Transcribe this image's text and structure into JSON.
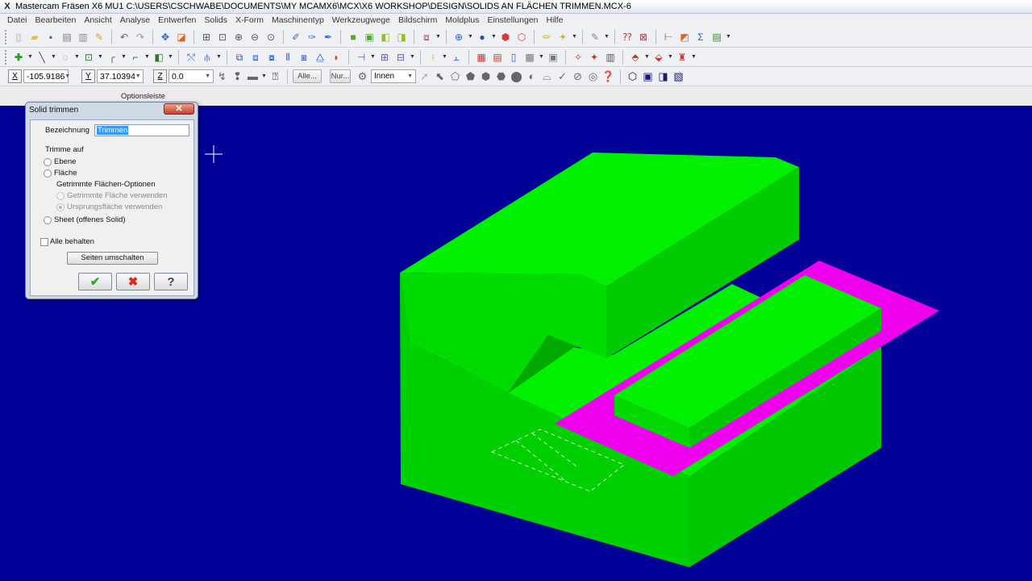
{
  "window": {
    "title": "Mastercam Fräsen X6 MU1  C:\\USERS\\CSCHWABE\\DOCUMENTS\\MY MCAMX6\\MCX\\X6 WORKSHOP\\DESIGN\\SOLIDS AN FLÄCHEN TRIMMEN.MCX-6",
    "app_icon": "X"
  },
  "menu": [
    "Datei",
    "Bearbeiten",
    "Ansicht",
    "Analyse",
    "Entwerfen",
    "Solids",
    "X-Form",
    "Maschinentyp",
    "Werkzeugwege",
    "Bildschirm",
    "Moldplus",
    "Einstellungen",
    "Hilfe"
  ],
  "ribbon": {
    "x_label": "X",
    "x_value": "-105.9186",
    "y_label": "Y",
    "y_value": "37.10394",
    "z_label": "Z",
    "z_value": "0.0",
    "alle_button": "Alle...",
    "nur_button": "Nur...",
    "mode_select": "Innen",
    "caption": "Optionsleiste"
  },
  "dialog": {
    "title": "Solid trimmen",
    "close_glyph": "✕",
    "name_label": "Bezeichnung",
    "name_value": "Trimmen",
    "trim_group_label": "Trimme auf",
    "option_plane": "Ebene",
    "option_surface": "Fläche",
    "surface_options_label": "Getrimmte Flächen-Optionen",
    "option_trimmed_surface": "Getrimmte Fläche verwenden",
    "option_original_surface": "Ursprungsfläche verwenden",
    "option_sheet": "Sheet (offenes Solid)",
    "keep_all_label": "Alle behalten",
    "switch_sides_button": "Seiten umschalten",
    "ok_glyph": "✔",
    "cancel_glyph": "✖",
    "help_glyph": "?"
  },
  "colors": {
    "viewport_bg": "#000096",
    "solid_light": "#00ee00",
    "solid_mid": "#00d400",
    "solid_dark": "#00b800",
    "surface": "#ee00ee",
    "dialog_frame": "#cfd9e6"
  },
  "toolbar_icons": {
    "row1": [
      "new-file-icon",
      "open-file-icon",
      "save-icon",
      "print-icon",
      "print-preview-icon",
      "clear-icon",
      "undo-icon",
      "redo-icon",
      "analyze-icon",
      "image-icon",
      "zoom-fit-icon",
      "zoom-window-icon",
      "zoom-in-icon",
      "zoom-out-icon",
      "zoom-prev-icon",
      "repaint-icon",
      "color-icon",
      "wireframe-icon",
      "shaded-icon",
      "hidden-icon",
      "view-icon",
      "globe-icon",
      "sphere-icon",
      "solid-icon",
      "cube-icon",
      "pen-icon",
      "gear-icon",
      "brush-icon",
      "help-icon",
      "chart-icon",
      "plot-icon",
      "sum-icon",
      "layer-icon"
    ],
    "row2": [
      "point-icon",
      "line-icon",
      "arc-icon",
      "rectangle-icon",
      "fillet-icon",
      "spline-icon",
      "surface-icon",
      "trim-icon",
      "extend-icon",
      "translate-icon",
      "rotate-icon",
      "mirror-icon",
      "scale-icon",
      "offset-icon",
      "array-icon",
      "move-icon",
      "drill-icon",
      "pocket-icon",
      "contour-icon",
      "face-icon",
      "dimension-icon",
      "grid-icon",
      "table-icon",
      "document-icon",
      "calculator-icon",
      "toolpath-icon",
      "simulate-icon",
      "verify-icon",
      "post-icon",
      "machine-icon"
    ]
  }
}
